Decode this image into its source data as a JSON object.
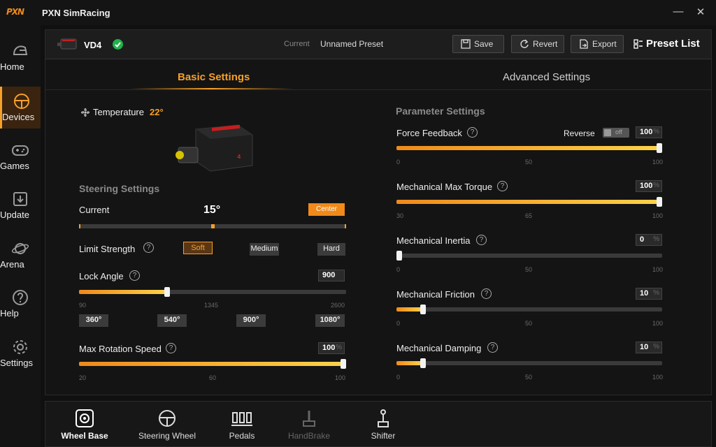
{
  "app": {
    "logo_text": "PXN",
    "title": "PXN SimRacing"
  },
  "window": {
    "minimize": "—",
    "close": "✕"
  },
  "sidebar": {
    "items": [
      {
        "label": "Home",
        "icon": "helmet-icon"
      },
      {
        "label": "Devices",
        "icon": "steering-wheel-icon"
      },
      {
        "label": "Games",
        "icon": "gamepad-icon"
      },
      {
        "label": "Update",
        "icon": "download-icon"
      },
      {
        "label": "Arena",
        "icon": "planet-icon"
      },
      {
        "label": "Help",
        "icon": "help-icon"
      },
      {
        "label": "Settings",
        "icon": "gear-icon"
      }
    ],
    "active": "Devices"
  },
  "header": {
    "device_name": "VD4",
    "current_label": "Current",
    "preset_name": "Unnamed Preset",
    "save_label": "Save",
    "revert_label": "Revert",
    "export_label": "Export",
    "preset_list_label": "Preset List"
  },
  "tabs": {
    "basic": "Basic Settings",
    "advanced": "Advanced Settings"
  },
  "temperature": {
    "label": "Temperature",
    "value": "22°"
  },
  "steering": {
    "title": "Steering Settings",
    "current_label": "Current",
    "current_value": "15°",
    "center_label": "Center",
    "current_fraction": 0.5,
    "limit_strength_label": "Limit Strength",
    "limit_options": [
      "Soft",
      "Medium",
      "Hard"
    ],
    "limit_selected": "Soft",
    "lock_angle_label": "Lock Angle",
    "lock_angle_value": "900",
    "lock_angle_ticks": [
      "90",
      "1345",
      "2600"
    ],
    "lock_angle_fraction": 0.33,
    "lock_presets": [
      "360°",
      "540°",
      "900°",
      "1080°"
    ],
    "max_rotation_label": "Max Rotation Speed",
    "max_rotation_value": "100",
    "max_rotation_unit": "%",
    "max_rotation_ticks": [
      "20",
      "60",
      "100"
    ],
    "max_rotation_fraction": 1.0
  },
  "parameters": {
    "title": "Parameter Settings",
    "reverse_label": "Reverse",
    "reverse_state": "off",
    "unit": "%",
    "items": [
      {
        "label": "Force Feedback",
        "value": "100",
        "fraction": 1.0,
        "ticks": [
          "0",
          "50",
          "100"
        ]
      },
      {
        "label": "Mechanical Max Torque",
        "value": "100",
        "fraction": 1.0,
        "ticks": [
          "30",
          "65",
          "100"
        ]
      },
      {
        "label": "Mechanical Inertia",
        "value": "0",
        "fraction": 0.0,
        "ticks": [
          "0",
          "50",
          "100"
        ]
      },
      {
        "label": "Mechanical Friction",
        "value": "10",
        "fraction": 0.1,
        "ticks": [
          "0",
          "50",
          "100"
        ]
      },
      {
        "label": "Mechanical Damping",
        "value": "10",
        "fraction": 0.1,
        "ticks": [
          "0",
          "50",
          "100"
        ]
      }
    ]
  },
  "bottom_nav": [
    {
      "label": "Wheel Base",
      "icon": "wheel-base-icon",
      "state": "active"
    },
    {
      "label": "Steering Wheel",
      "icon": "steering-wheel-icon",
      "state": "normal"
    },
    {
      "label": "Pedals",
      "icon": "pedals-icon",
      "state": "normal"
    },
    {
      "label": "HandBrake",
      "icon": "handbrake-icon",
      "state": "disabled"
    },
    {
      "label": "Shifter",
      "icon": "shifter-icon",
      "state": "normal"
    }
  ],
  "colors": {
    "accent": "#f5a029",
    "ok": "#22b04b",
    "bg": "#101010"
  }
}
